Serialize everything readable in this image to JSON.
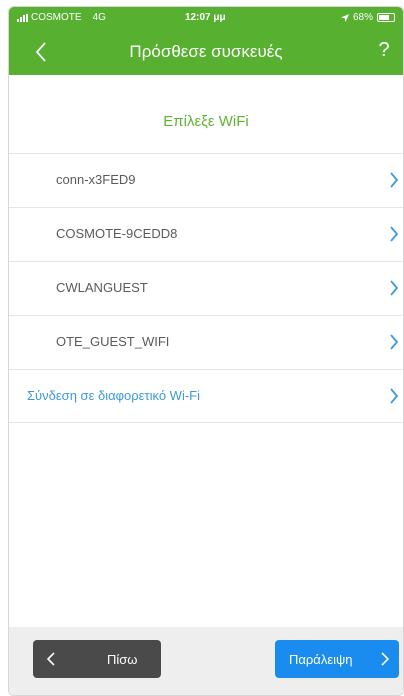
{
  "status_bar": {
    "carrier": "COSMOTE",
    "network": "4G",
    "time": "12:07 μμ",
    "battery": "68%"
  },
  "nav": {
    "title": "Πρόσθεσε συσκευές",
    "help_label": "?"
  },
  "section": {
    "title": "Επίλεξε WiFi"
  },
  "networks": [
    {
      "label": "conn-x3FED9"
    },
    {
      "label": "COSMOTE-9CEDD8"
    },
    {
      "label": "CWLANGUEST"
    },
    {
      "label": "OTE_GUEST_WIFI"
    }
  ],
  "other_network": {
    "label": "Σύνδεση σε διαφορετικό Wi-Fi"
  },
  "footer": {
    "back_label": "Πίσω",
    "skip_label": "Παράλειψη"
  },
  "colors": {
    "header": "#58b030",
    "accent_green": "#5eb234",
    "link_blue": "#3d9ad9",
    "skip_button": "#1a8cf0",
    "back_button": "#4a4a4a"
  }
}
